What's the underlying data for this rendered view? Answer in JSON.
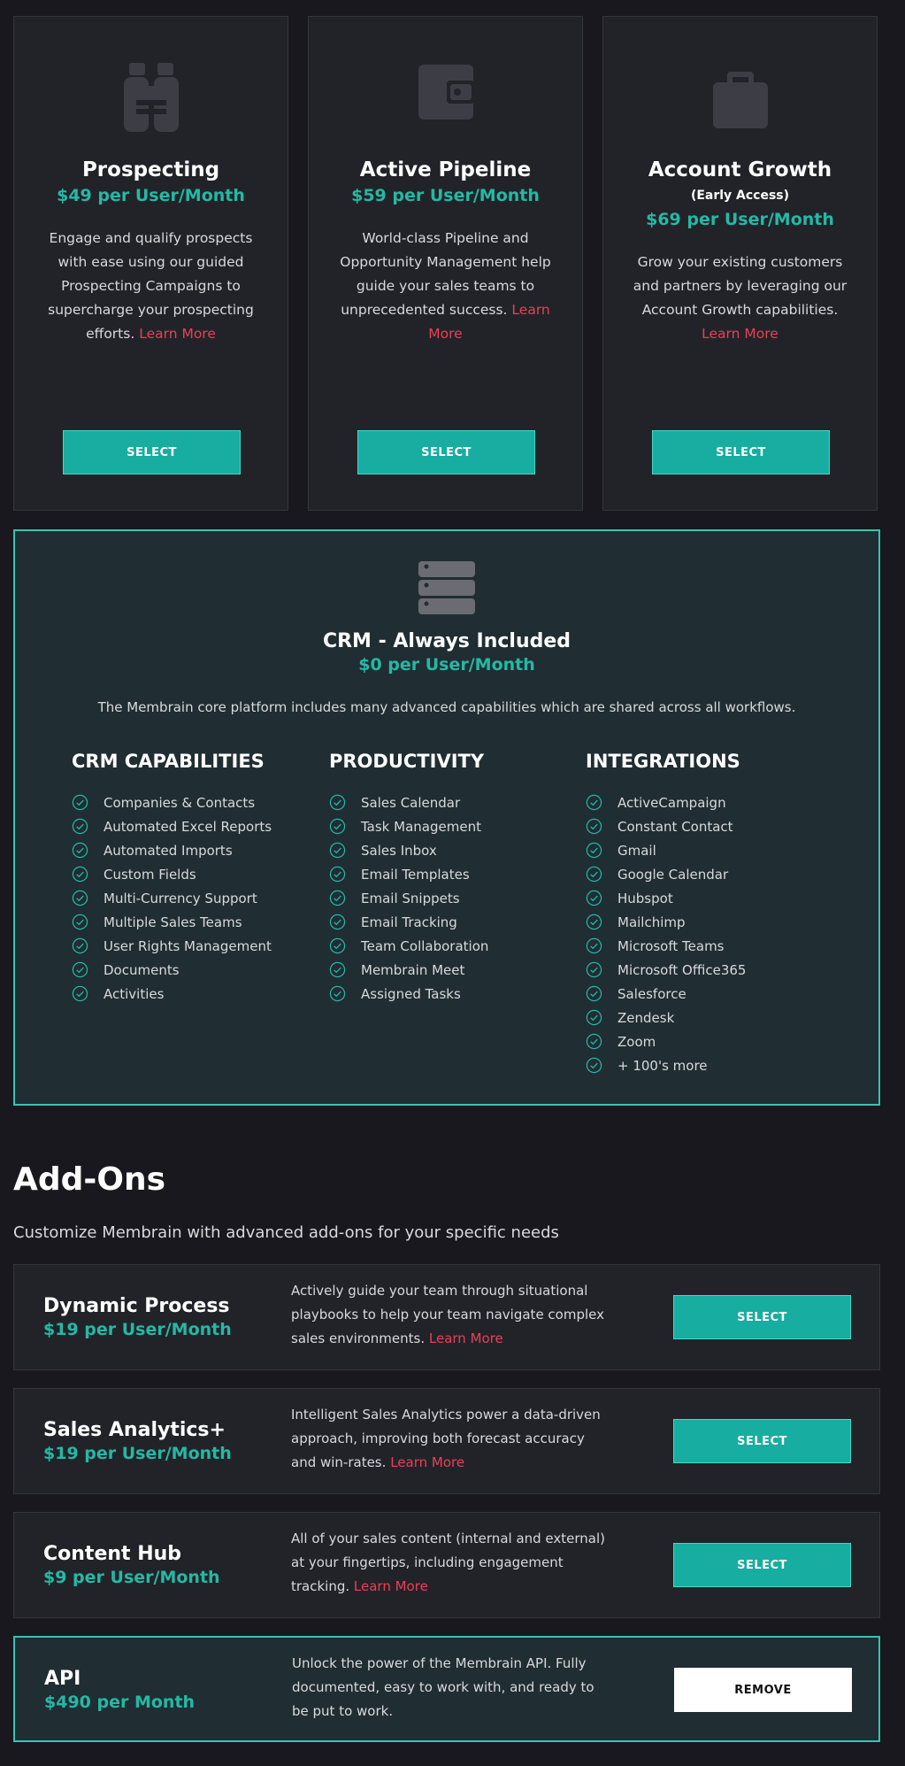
{
  "plans": [
    {
      "icon": "binoculars-icon",
      "title": "Prospecting",
      "subtitle": "",
      "price": "$49 per User/Month",
      "desc": "Engage and qualify prospects with ease using our guided Prospecting Campaigns to supercharge your prospecting efforts.",
      "learn": "Learn More",
      "button": "SELECT"
    },
    {
      "icon": "wallet-icon",
      "title": "Active Pipeline",
      "subtitle": "",
      "price": "$59 per User/Month",
      "desc": "World-class Pipeline and Opportunity Management help guide your sales teams to unprecedented success.",
      "learn": "Learn More",
      "button": "SELECT"
    },
    {
      "icon": "briefcase-icon",
      "title": "Account Growth",
      "subtitle": "(Early Access)",
      "price": "$69 per User/Month",
      "desc": "Grow your existing customers and partners by leveraging our Account Growth capabilities.",
      "learn": "Learn More",
      "button": "SELECT"
    }
  ],
  "crm": {
    "icon": "server-icon",
    "title": "CRM - Always Included",
    "price": "$0 per User/Month",
    "desc": "The Membrain core platform includes many advanced capabilities which are shared across all workflows.",
    "columns": [
      {
        "heading": "CRM CAPABILITIES",
        "items": [
          "Companies & Contacts",
          "Automated Excel Reports",
          "Automated Imports",
          "Custom Fields",
          "Multi-Currency Support",
          "Multiple Sales Teams",
          "User Rights Management",
          "Documents",
          "Activities"
        ]
      },
      {
        "heading": "PRODUCTIVITY",
        "items": [
          "Sales Calendar",
          "Task Management",
          "Sales Inbox",
          "Email Templates",
          "Email Snippets",
          "Email Tracking",
          "Team Collaboration",
          "Membrain Meet",
          "Assigned Tasks"
        ]
      },
      {
        "heading": "INTEGRATIONS",
        "items": [
          "ActiveCampaign",
          "Constant Contact",
          "Gmail",
          "Google Calendar",
          "Hubspot",
          "Mailchimp",
          "Microsoft Teams",
          "Microsoft Office365",
          "Salesforce",
          "Zendesk",
          "Zoom",
          "+ 100's more"
        ]
      }
    ]
  },
  "addons_header": {
    "title": "Add-Ons",
    "subtitle": "Customize Membrain with advanced add-ons for your specific needs"
  },
  "addons": [
    {
      "name": "Dynamic Process",
      "price": "$19 per User/Month",
      "desc": "Actively guide your team through situational playbooks to help your team navigate complex sales environments.",
      "learn": "Learn More",
      "button": "SELECT",
      "selected": false
    },
    {
      "name": "Sales Analytics+",
      "price": "$19 per User/Month",
      "desc": "Intelligent Sales Analytics power a data-driven approach, improving both forecast accuracy and win-rates.",
      "learn": "Learn More",
      "button": "SELECT",
      "selected": false
    },
    {
      "name": "Content Hub",
      "price": "$9 per User/Month",
      "desc": "All of your sales content (internal and external) at your fingertips, including engagement tracking.",
      "learn": "Learn More",
      "button": "SELECT",
      "selected": false
    },
    {
      "name": "API",
      "price": "$490 per Month",
      "desc": "Unlock the power of the Membrain API. Fully documented, easy to work with, and ready to be put to work.",
      "learn": "",
      "button": "REMOVE",
      "selected": true
    }
  ],
  "colors": {
    "background": "#18181e",
    "card": "#222328",
    "accent": "#17ada0",
    "price": "#25b8a5",
    "link": "#e8405a",
    "selected_border": "#37c3b1"
  }
}
